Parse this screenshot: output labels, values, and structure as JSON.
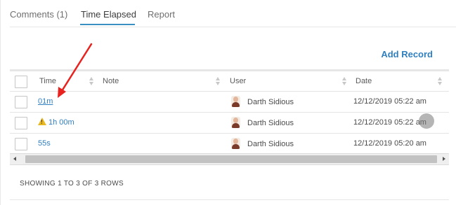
{
  "tabs": [
    {
      "label": "Comments (1)"
    },
    {
      "label": "Time Elapsed"
    },
    {
      "label": "Report"
    }
  ],
  "active_tab": "Time Elapsed",
  "add_record_label": "Add Record",
  "table": {
    "columns": [
      "Time",
      "Note",
      "User",
      "Date"
    ],
    "rows": [
      {
        "time": "01m",
        "note": "",
        "user": "Darth Sidious",
        "date": "12/12/2019 05:22 am",
        "warning": false
      },
      {
        "time": "1h 00m",
        "note": "",
        "user": "Darth Sidious",
        "date": "12/12/2019 05:22 am",
        "warning": true
      },
      {
        "time": "55s",
        "note": "",
        "user": "Darth Sidious",
        "date": "12/12/2019 05:20 am",
        "warning": false
      }
    ]
  },
  "pagination": {
    "summary": "SHOWING 1 TO 3 OF 3 ROWS"
  },
  "icons": {
    "warning": "warning-triangle-icon",
    "sort": "sort-arrows-icon",
    "avatar": "user-avatar-icon"
  },
  "colors": {
    "link": "#2f7fbf",
    "tab_active_underline": "#3a8fc2",
    "annotation_arrow": "#e8231f",
    "warning": "#e8b923"
  }
}
